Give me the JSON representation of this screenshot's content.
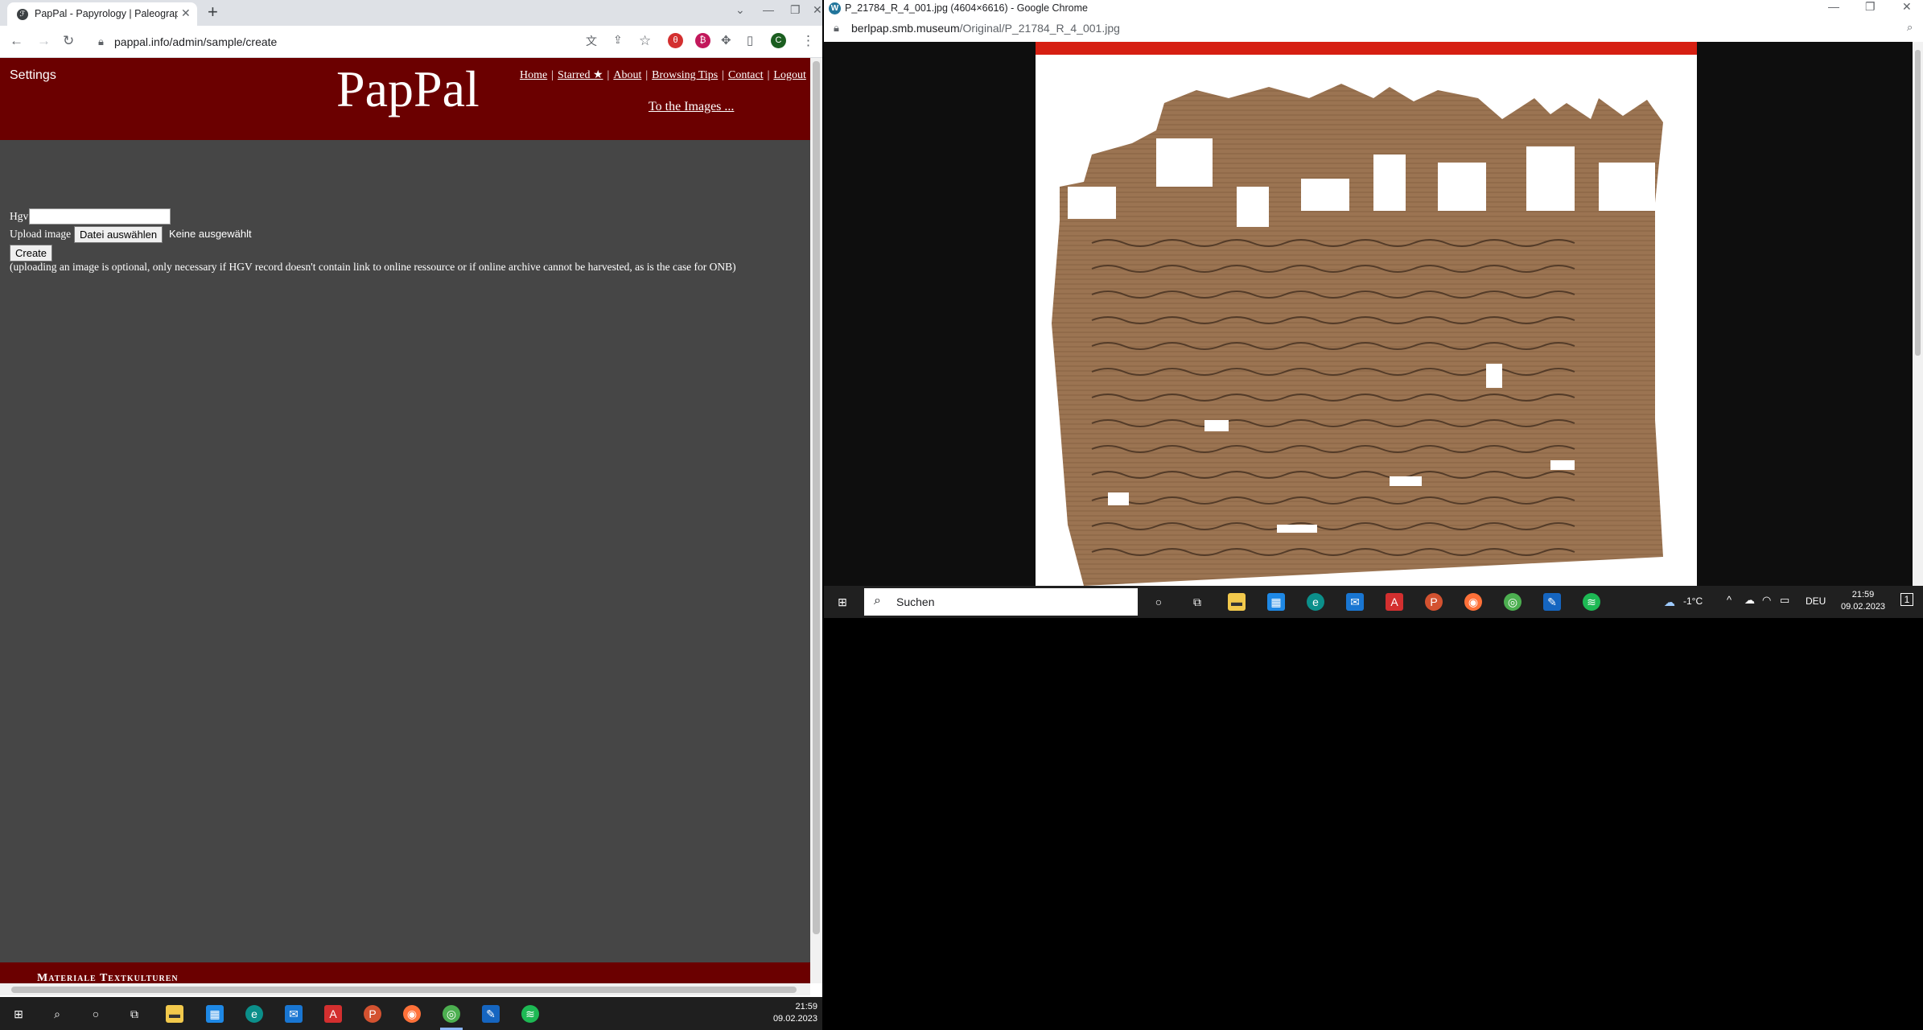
{
  "left_browser": {
    "tab_title": "PapPal - Papyrology | Paleography",
    "tab_favicon": "ℱ",
    "url": "pappal.info/admin/sample/create",
    "profile_initial": "C"
  },
  "site": {
    "settings_label": "Settings",
    "logo": "PapPal",
    "nav": [
      "Home",
      "Starred ★",
      "About",
      "Browsing Tips",
      "Contact",
      "Logout"
    ],
    "images_link": "To the Images ...",
    "footer_text": "Materiale Textkulturen"
  },
  "form": {
    "hgv_label": "Hgv",
    "hgv_value": "",
    "upload_label": "Upload image",
    "file_button": "Datei auswählen",
    "file_status": "Keine ausgewählt",
    "create_button": "Create",
    "note": "(uploading an image is optional, only necessary if HGV record doesn't contain link to online ressource or if online archive cannot be harvested, as is the case for ONB)"
  },
  "taskbar_left": {
    "time": "21:59",
    "date": "09.02.2023"
  },
  "right_browser": {
    "title": "P_21784_R_4_001.jpg (4604×6616) - Google Chrome",
    "url_domain": "berlpap.smb.museum",
    "url_path": "/Original/P_21784_R_4_001.jpg"
  },
  "taskbar_right": {
    "search_placeholder": "Suchen",
    "weather": "-1°C",
    "language": "DEU",
    "time": "21:59",
    "date": "09.02.2023",
    "notification_count": "1"
  },
  "colors": {
    "header_red": "#6b0000",
    "page_gray": "#464646"
  }
}
